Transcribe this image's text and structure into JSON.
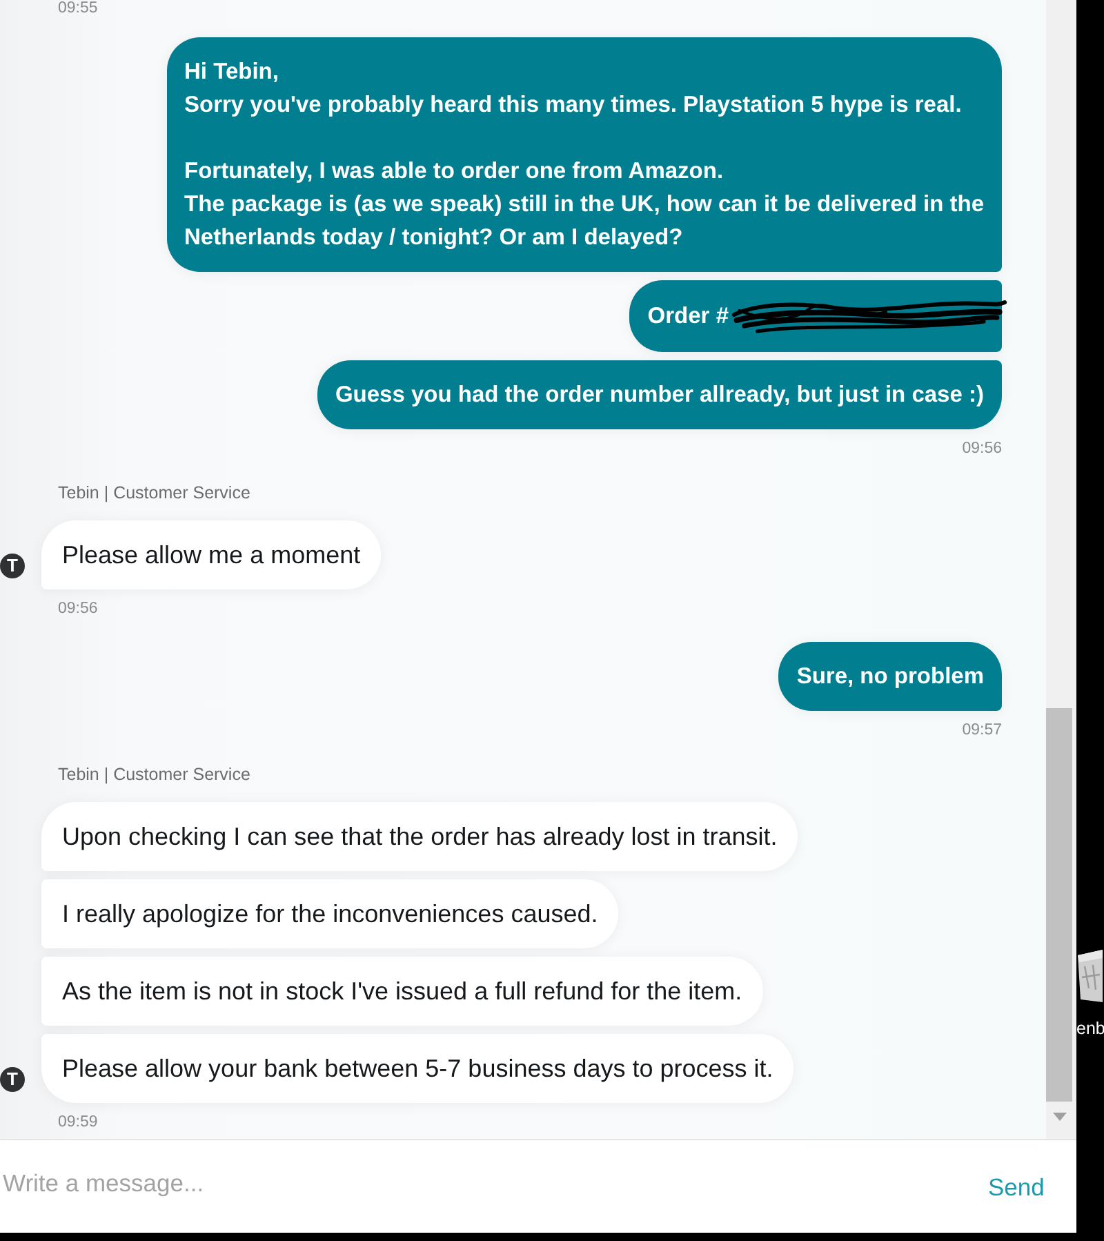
{
  "chat": {
    "earlier_time": "09:55",
    "groups": [
      {
        "kind": "customer",
        "messages": [
          {
            "text": "Hi Tebin,\nSorry you've probably heard this many times. Playstation 5 hype is real.\n\nFortunately, I was able to order one from Amazon.\nThe package is (as we speak) still in the UK, how can it be delivered in the\nNetherlands today / tonight? Or am I delayed?",
            "redacted": false
          },
          {
            "text": "Order #",
            "redacted": true
          },
          {
            "text": "Guess you had the order number allready, but just in case :)",
            "redacted": false
          }
        ],
        "time": "09:56"
      },
      {
        "kind": "agent",
        "agent_name": "Tebin | Customer Service",
        "avatar": "T",
        "messages": [
          {
            "text": "Please allow me a moment",
            "redacted": false
          }
        ],
        "time": "09:56"
      },
      {
        "kind": "customer",
        "messages": [
          {
            "text": "Sure, no problem",
            "redacted": false
          }
        ],
        "time": "09:57"
      },
      {
        "kind": "agent",
        "agent_name": "Tebin | Customer Service",
        "avatar": "T",
        "messages": [
          {
            "text": "Upon checking I can see that the order has already lost in transit.",
            "redacted": false
          },
          {
            "text": "I really apologize for the inconveniences caused.",
            "redacted": false
          },
          {
            "text": "As the item is not in stock I've issued a full refund for the item.",
            "redacted": false
          },
          {
            "text": "Please allow your bank between 5-7 business days to process it.",
            "redacted": false
          }
        ],
        "time": "09:59"
      }
    ]
  },
  "composer": {
    "placeholder": "Write a message...",
    "send_label": "Send"
  },
  "desktop": {
    "icon_label": "enb"
  }
}
